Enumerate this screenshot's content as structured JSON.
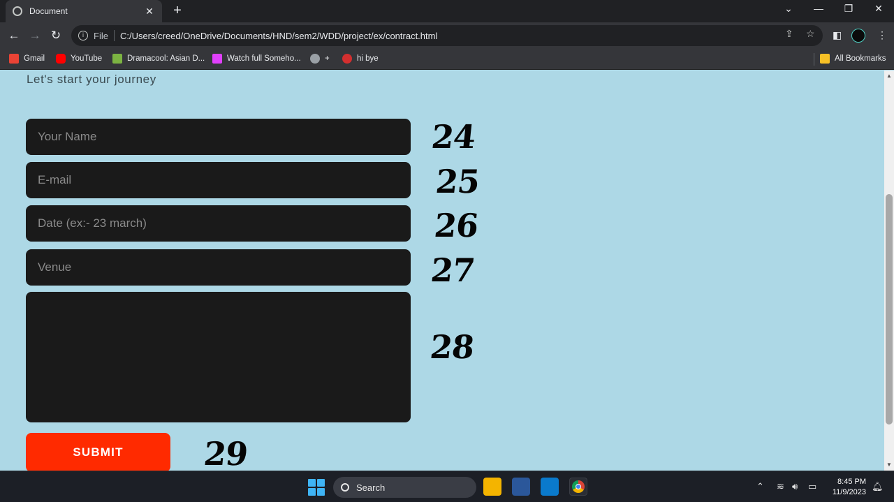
{
  "browser": {
    "tab_title": "Document",
    "tab_close": "✕",
    "new_tab": "+",
    "file_label": "File",
    "url": "C:/Users/creed/OneDrive/Documents/HND/sem2/WDD/project/ex/contract.html",
    "bookmarks": [
      {
        "label": "Gmail",
        "icon": "gmail-icon",
        "color": "#ea4335"
      },
      {
        "label": "YouTube",
        "icon": "youtube-icon",
        "color": "#ff0000"
      },
      {
        "label": "Dramacool: Asian D...",
        "icon": "dramacool-icon",
        "color": "#7cb342"
      },
      {
        "label": "Watch full Someho...",
        "icon": "watch-icon",
        "color": "#e040fb"
      },
      {
        "label": "+",
        "icon": "globe-icon",
        "color": "#9aa0a6"
      },
      {
        "label": "hi bye",
        "icon": "m-icon",
        "color": "#d32f2f"
      }
    ],
    "all_bookmarks": "All Bookmarks"
  },
  "page": {
    "subtitle": "Let's start your journey",
    "fields": {
      "name_placeholder": "Your Name",
      "email_placeholder": "E-mail",
      "date_placeholder": "Date (ex:- 23 march)",
      "venue_placeholder": "Venue"
    },
    "submit_label": "SUBMIT",
    "annotations": [
      "24",
      "25",
      "26",
      "27",
      "28",
      "29"
    ]
  },
  "taskbar": {
    "search_label": "Search",
    "time": "8:45 PM",
    "date": "11/9/2023"
  },
  "colors": {
    "page_bg": "#add8e6",
    "field_bg": "#1a1a1a",
    "submit_bg": "#ff2a00"
  }
}
